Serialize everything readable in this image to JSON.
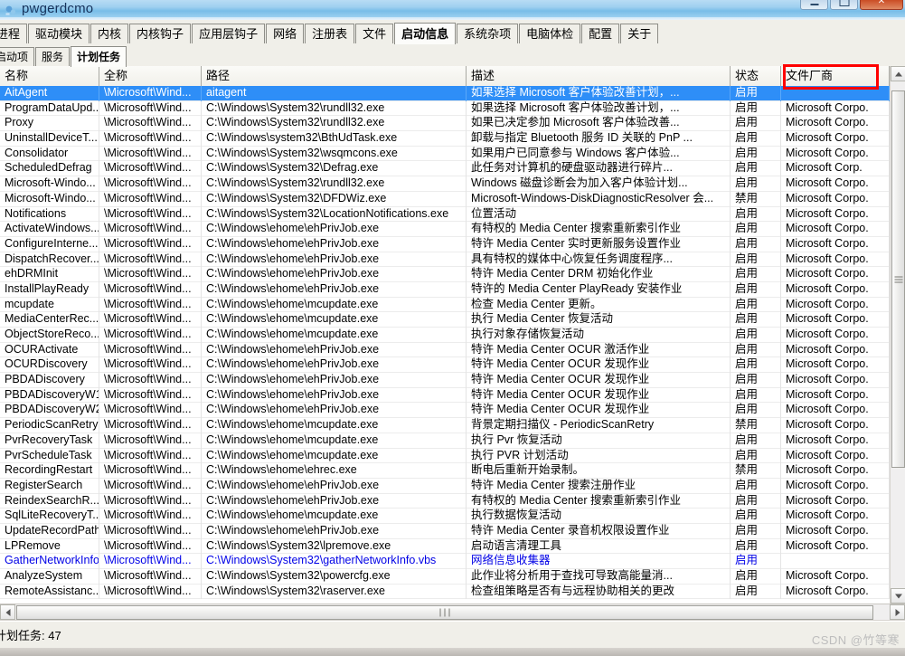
{
  "window": {
    "title": "pwgerdcmo",
    "icon": "app-icon",
    "controls": {
      "minimize": "minimize",
      "maximize": "maximize",
      "close": "close"
    }
  },
  "tabs_primary": {
    "items": [
      {
        "label": "进程",
        "active": false
      },
      {
        "label": "驱动模块",
        "active": false
      },
      {
        "label": "内核",
        "active": false
      },
      {
        "label": "内核钩子",
        "active": false
      },
      {
        "label": "应用层钩子",
        "active": false
      },
      {
        "label": "网络",
        "active": false
      },
      {
        "label": "注册表",
        "active": false
      },
      {
        "label": "文件",
        "active": false
      },
      {
        "label": "启动信息",
        "active": true
      },
      {
        "label": "系统杂项",
        "active": false
      },
      {
        "label": "电脑体检",
        "active": false
      },
      {
        "label": "配置",
        "active": false
      },
      {
        "label": "关于",
        "active": false
      }
    ]
  },
  "tabs_secondary": {
    "items": [
      {
        "label": "启动项",
        "active": false
      },
      {
        "label": "服务",
        "active": false
      },
      {
        "label": "计划任务",
        "active": true
      }
    ]
  },
  "table": {
    "columns": [
      "名称",
      "全称",
      "路径",
      "描述",
      "状态",
      "文件厂商"
    ],
    "highlight_column": "文件厂商",
    "highlight_color": "#ff0000",
    "rows": [
      {
        "name": "AitAgent",
        "full": "\\Microsoft\\Wind...",
        "path": "aitagent",
        "desc": "如果选择 Microsoft 客户体验改善计划，...",
        "state": "启用",
        "vendor": "",
        "selected": true,
        "blue": false
      },
      {
        "name": "ProgramDataUpd...",
        "full": "\\Microsoft\\Wind...",
        "path": "C:\\Windows\\System32\\rundll32.exe",
        "desc": "如果选择 Microsoft 客户体验改善计划，...",
        "state": "启用",
        "vendor": "Microsoft Corpo.",
        "selected": false,
        "blue": false
      },
      {
        "name": "Proxy",
        "full": "\\Microsoft\\Wind...",
        "path": "C:\\Windows\\System32\\rundll32.exe",
        "desc": "如果已决定参加 Microsoft 客户体验改善...",
        "state": "启用",
        "vendor": "Microsoft Corpo.",
        "selected": false,
        "blue": false
      },
      {
        "name": "UninstallDeviceT...",
        "full": "\\Microsoft\\Wind...",
        "path": "C:\\Windows\\system32\\BthUdTask.exe",
        "desc": "卸载与指定 Bluetooth 服务 ID 关联的 PnP ...",
        "state": "启用",
        "vendor": "Microsoft Corpo.",
        "selected": false,
        "blue": false
      },
      {
        "name": "Consolidator",
        "full": "\\Microsoft\\Wind...",
        "path": "C:\\Windows\\System32\\wsqmcons.exe",
        "desc": "如果用户已同意参与 Windows 客户体验...",
        "state": "启用",
        "vendor": "Microsoft Corpo.",
        "selected": false,
        "blue": false
      },
      {
        "name": "ScheduledDefrag",
        "full": "\\Microsoft\\Wind...",
        "path": "C:\\Windows\\System32\\Defrag.exe",
        "desc": "此任务对计算机的硬盘驱动器进行碎片...",
        "state": "启用",
        "vendor": "Microsoft Corp.",
        "selected": false,
        "blue": false
      },
      {
        "name": "Microsoft-Windo...",
        "full": "\\Microsoft\\Wind...",
        "path": "C:\\Windows\\System32\\rundll32.exe",
        "desc": "Windows 磁盘诊断会为加入客户体验计划...",
        "state": "启用",
        "vendor": "Microsoft Corpo.",
        "selected": false,
        "blue": false
      },
      {
        "name": "Microsoft-Windo...",
        "full": "\\Microsoft\\Wind...",
        "path": "C:\\Windows\\System32\\DFDWiz.exe",
        "desc": "Microsoft-Windows-DiskDiagnosticResolver 会...",
        "state": "禁用",
        "vendor": "Microsoft Corpo.",
        "selected": false,
        "blue": false
      },
      {
        "name": "Notifications",
        "full": "\\Microsoft\\Wind...",
        "path": "C:\\Windows\\System32\\LocationNotifications.exe",
        "desc": "位置活动",
        "state": "启用",
        "vendor": "Microsoft Corpo.",
        "selected": false,
        "blue": false
      },
      {
        "name": "ActivateWindows...",
        "full": "\\Microsoft\\Wind...",
        "path": "C:\\Windows\\ehome\\ehPrivJob.exe",
        "desc": "有特权的 Media Center 搜索重新索引作业",
        "state": "启用",
        "vendor": "Microsoft Corpo.",
        "selected": false,
        "blue": false
      },
      {
        "name": "ConfigureInterne...",
        "full": "\\Microsoft\\Wind...",
        "path": "C:\\Windows\\ehome\\ehPrivJob.exe",
        "desc": "特许 Media Center 实时更新服务设置作业",
        "state": "启用",
        "vendor": "Microsoft Corpo.",
        "selected": false,
        "blue": false
      },
      {
        "name": "DispatchRecover...",
        "full": "\\Microsoft\\Wind...",
        "path": "C:\\Windows\\ehome\\ehPrivJob.exe",
        "desc": "具有特权的媒体中心恢复任务调度程序...",
        "state": "启用",
        "vendor": "Microsoft Corpo.",
        "selected": false,
        "blue": false
      },
      {
        "name": "ehDRMInit",
        "full": "\\Microsoft\\Wind...",
        "path": "C:\\Windows\\ehome\\ehPrivJob.exe",
        "desc": "特许 Media Center DRM 初始化作业",
        "state": "启用",
        "vendor": "Microsoft Corpo.",
        "selected": false,
        "blue": false
      },
      {
        "name": "InstallPlayReady",
        "full": "\\Microsoft\\Wind...",
        "path": "C:\\Windows\\ehome\\ehPrivJob.exe",
        "desc": "特许的 Media Center PlayReady 安装作业",
        "state": "启用",
        "vendor": "Microsoft Corpo.",
        "selected": false,
        "blue": false
      },
      {
        "name": "mcupdate",
        "full": "\\Microsoft\\Wind...",
        "path": "C:\\Windows\\ehome\\mcupdate.exe",
        "desc": "检查 Media Center 更新。",
        "state": "启用",
        "vendor": "Microsoft Corpo.",
        "selected": false,
        "blue": false
      },
      {
        "name": "MediaCenterRec...",
        "full": "\\Microsoft\\Wind...",
        "path": "C:\\Windows\\ehome\\mcupdate.exe",
        "desc": "执行 Media Center 恢复活动",
        "state": "启用",
        "vendor": "Microsoft Corpo.",
        "selected": false,
        "blue": false
      },
      {
        "name": "ObjectStoreReco...",
        "full": "\\Microsoft\\Wind...",
        "path": "C:\\Windows\\ehome\\mcupdate.exe",
        "desc": "执行对象存储恢复活动",
        "state": "启用",
        "vendor": "Microsoft Corpo.",
        "selected": false,
        "blue": false
      },
      {
        "name": "OCURActivate",
        "full": "\\Microsoft\\Wind...",
        "path": "C:\\Windows\\ehome\\ehPrivJob.exe",
        "desc": "特许 Media Center OCUR 激活作业",
        "state": "启用",
        "vendor": "Microsoft Corpo.",
        "selected": false,
        "blue": false
      },
      {
        "name": "OCURDiscovery",
        "full": "\\Microsoft\\Wind...",
        "path": "C:\\Windows\\ehome\\ehPrivJob.exe",
        "desc": "特许 Media Center OCUR 发现作业",
        "state": "启用",
        "vendor": "Microsoft Corpo.",
        "selected": false,
        "blue": false
      },
      {
        "name": "PBDADiscovery",
        "full": "\\Microsoft\\Wind...",
        "path": "C:\\Windows\\ehome\\ehPrivJob.exe",
        "desc": "特许 Media Center OCUR 发现作业",
        "state": "启用",
        "vendor": "Microsoft Corpo.",
        "selected": false,
        "blue": false
      },
      {
        "name": "PBDADiscoveryW1",
        "full": "\\Microsoft\\Wind...",
        "path": "C:\\Windows\\ehome\\ehPrivJob.exe",
        "desc": "特许 Media Center OCUR 发现作业",
        "state": "启用",
        "vendor": "Microsoft Corpo.",
        "selected": false,
        "blue": false
      },
      {
        "name": "PBDADiscoveryW2",
        "full": "\\Microsoft\\Wind...",
        "path": "C:\\Windows\\ehome\\ehPrivJob.exe",
        "desc": "特许 Media Center OCUR 发现作业",
        "state": "启用",
        "vendor": "Microsoft Corpo.",
        "selected": false,
        "blue": false
      },
      {
        "name": "PeriodicScanRetry",
        "full": "\\Microsoft\\Wind...",
        "path": "C:\\Windows\\ehome\\mcupdate.exe",
        "desc": "背景定期扫描仪 - PeriodicScanRetry",
        "state": "禁用",
        "vendor": "Microsoft Corpo.",
        "selected": false,
        "blue": false
      },
      {
        "name": "PvrRecoveryTask",
        "full": "\\Microsoft\\Wind...",
        "path": "C:\\Windows\\ehome\\mcupdate.exe",
        "desc": "执行 Pvr 恢复活动",
        "state": "启用",
        "vendor": "Microsoft Corpo.",
        "selected": false,
        "blue": false
      },
      {
        "name": "PvrScheduleTask",
        "full": "\\Microsoft\\Wind...",
        "path": "C:\\Windows\\ehome\\mcupdate.exe",
        "desc": "执行 PVR 计划活动",
        "state": "启用",
        "vendor": "Microsoft Corpo.",
        "selected": false,
        "blue": false
      },
      {
        "name": "RecordingRestart",
        "full": "\\Microsoft\\Wind...",
        "path": "C:\\Windows\\ehome\\ehrec.exe",
        "desc": "断电后重新开始录制。",
        "state": "禁用",
        "vendor": "Microsoft Corpo.",
        "selected": false,
        "blue": false
      },
      {
        "name": "RegisterSearch",
        "full": "\\Microsoft\\Wind...",
        "path": "C:\\Windows\\ehome\\ehPrivJob.exe",
        "desc": "特许 Media Center 搜索注册作业",
        "state": "启用",
        "vendor": "Microsoft Corpo.",
        "selected": false,
        "blue": false
      },
      {
        "name": "ReindexSearchR...",
        "full": "\\Microsoft\\Wind...",
        "path": "C:\\Windows\\ehome\\ehPrivJob.exe",
        "desc": "有特权的 Media Center 搜索重新索引作业",
        "state": "启用",
        "vendor": "Microsoft Corpo.",
        "selected": false,
        "blue": false
      },
      {
        "name": "SqlLiteRecoveryT...",
        "full": "\\Microsoft\\Wind...",
        "path": "C:\\Windows\\ehome\\mcupdate.exe",
        "desc": "执行数据恢复活动",
        "state": "启用",
        "vendor": "Microsoft Corpo.",
        "selected": false,
        "blue": false
      },
      {
        "name": "UpdateRecordPath",
        "full": "\\Microsoft\\Wind...",
        "path": "C:\\Windows\\ehome\\ehPrivJob.exe",
        "desc": "特许 Media Center 录音机权限设置作业",
        "state": "启用",
        "vendor": "Microsoft Corpo.",
        "selected": false,
        "blue": false
      },
      {
        "name": "LPRemove",
        "full": "\\Microsoft\\Wind...",
        "path": "C:\\Windows\\System32\\lpremove.exe",
        "desc": "启动语言清理工具",
        "state": "启用",
        "vendor": "Microsoft Corpo.",
        "selected": false,
        "blue": false
      },
      {
        "name": "GatherNetworkInfo",
        "full": "\\Microsoft\\Wind...",
        "path": "C:\\Windows\\System32\\gatherNetworkInfo.vbs",
        "desc": "网络信息收集器",
        "state": "启用",
        "vendor": "",
        "selected": false,
        "blue": true
      },
      {
        "name": "AnalyzeSystem",
        "full": "\\Microsoft\\Wind...",
        "path": "C:\\Windows\\System32\\powercfg.exe",
        "desc": "此作业将分析用于查找可导致高能量消...",
        "state": "启用",
        "vendor": "Microsoft Corpo.",
        "selected": false,
        "blue": false
      },
      {
        "name": "RemoteAssistanc...",
        "full": "\\Microsoft\\Wind...",
        "path": "C:\\Windows\\System32\\raserver.exe",
        "desc": "检查组策略是否有与远程协助相关的更改",
        "state": "启用",
        "vendor": "Microsoft Corpo.",
        "selected": false,
        "blue": false
      }
    ]
  },
  "status": {
    "label": "计划任务:",
    "count": "47"
  },
  "watermark": "CSDN @竹等寒"
}
